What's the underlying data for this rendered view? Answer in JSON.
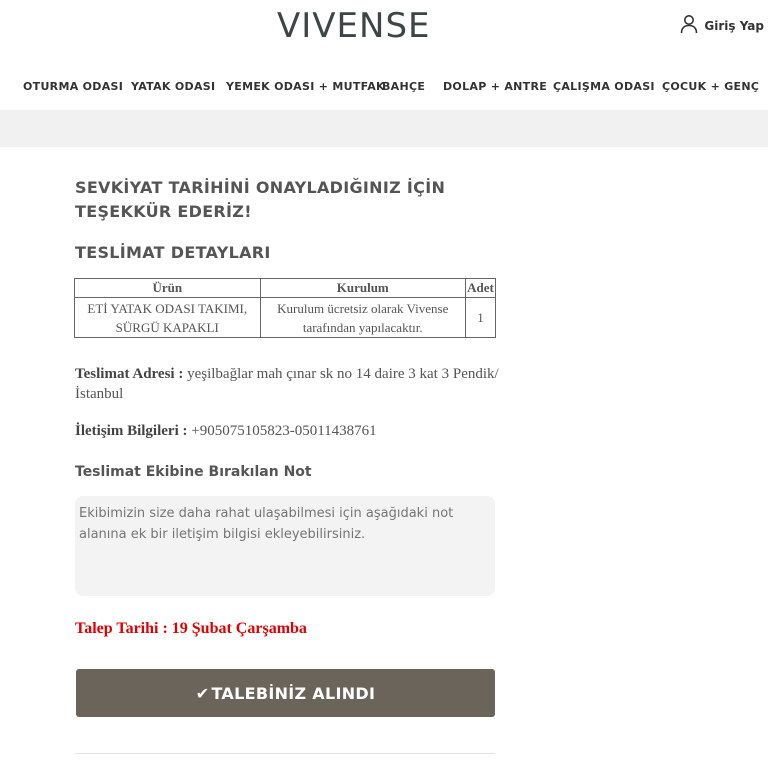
{
  "header": {
    "logo": "VIVENSE",
    "login_label": "Giriş Yap"
  },
  "nav": {
    "items": [
      "OTURMA ODASI",
      "YATAK ODASI",
      "YEMEK ODASI + MUTFAK",
      "BAHÇE",
      "DOLAP + ANTRE",
      "ÇALIŞMA ODASI",
      "ÇOCUK + GENÇ"
    ]
  },
  "main": {
    "thanks_title": "SEVKİYAT TARİHİNİ ONAYLADIĞINIZ İÇİN TEŞEKKÜR EDERİZ!",
    "details_title": "TESLİMAT DETAYLARI",
    "table": {
      "headers": [
        "Ürün",
        "Kurulum",
        "Adet"
      ],
      "rows": [
        [
          "ETİ YATAK ODASI TAKIMI, SÜRGÜ KAPAKLI",
          "Kurulum ücretsiz olarak Vivense tarafından yapılacaktır.",
          "1"
        ]
      ]
    },
    "address_label": "Teslimat Adresi :",
    "address_value": "yeşilbağlar mah çınar sk no 14 daire 3 kat 3 Pendik/ İstanbul",
    "contact_label": "İletişim Bilgileri :",
    "contact_value": "+905075105823-05011438761",
    "note_title": "Teslimat Ekibine Bırakılan Not",
    "note_placeholder": "Ekibimizin size daha rahat ulaşabilmesi için aşağıdaki not alanına ek bir iletişim bilgisi ekleyebilirsiniz.",
    "request_date": "Talep Tarihi : 19 Şubat Çarşamba",
    "confirm_button": "TALEBİNİZ ALINDI",
    "colors": {
      "button_bg": "#6b645a",
      "alert_red": "#e00000"
    }
  }
}
